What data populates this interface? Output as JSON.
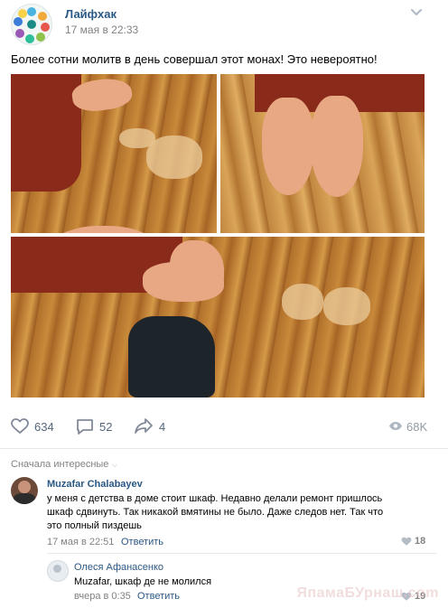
{
  "post": {
    "group_name": "Лайфхак",
    "date": "17 мая в 22:33",
    "text": "Более сотни молитв в день совершал этот монах! Это невероятно!"
  },
  "actions": {
    "likes": "634",
    "comments": "52",
    "shares": "4",
    "views": "68K"
  },
  "comments_header": {
    "sort_label": "Сначала интересные"
  },
  "comments": [
    {
      "author": "Muzafar Chalabayev",
      "text_lines": [
        "у меня с детства в доме стоит шкаф. Недавно делали ремонт пришлось",
        "шкаф сдвинуть. Так никакой вмятины не было. Даже следов нет. Так что",
        "это полный пиздешь"
      ],
      "date": "17 мая в 22:51",
      "reply_label": "Ответить",
      "likes": "18"
    },
    {
      "author": "Олеся Афанасенко",
      "text": "Muzafar, шкаф де не молился",
      "date": "вчера в 0:35",
      "reply_label": "Ответить",
      "likes": "19"
    }
  ],
  "watermark": "ЯпамаБУрнаш.com",
  "colors": {
    "link": "#2a5885",
    "meta": "#828282",
    "action": "#55677d",
    "heart": "#e64646"
  }
}
